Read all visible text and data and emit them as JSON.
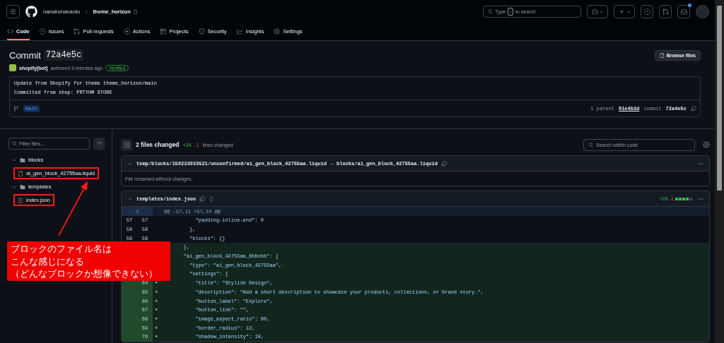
{
  "header": {
    "owner": "nanaironanaoto",
    "separator": "/",
    "repo": "theme_horizon",
    "search": {
      "prefix": "Type",
      "key": "/",
      "suffix": "to search"
    },
    "inbox_unread": true
  },
  "nav": [
    {
      "label": "Code",
      "selected": true
    },
    {
      "label": "Issues",
      "selected": false
    },
    {
      "label": "Pull requests",
      "selected": false
    },
    {
      "label": "Actions",
      "selected": false
    },
    {
      "label": "Projects",
      "selected": false
    },
    {
      "label": "Security",
      "selected": false
    },
    {
      "label": "Insights",
      "selected": false
    },
    {
      "label": "Settings",
      "selected": false
    }
  ],
  "commit": {
    "title": "Commit",
    "sha": "72a4e5c",
    "author": "shopify[bot]",
    "authored": "authored 3 minutes ago",
    "badge": "Verified",
    "browse": "Browse files",
    "message": "Update from Shopify for theme theme_horizon/main",
    "body": "Committed from shop: PRTYHM STORE",
    "branch": "main",
    "parent_label": "1 parent",
    "parent_sha": "01e4b3d",
    "commit_label": "commit",
    "commit_sha": "72a4e5c"
  },
  "sidebar": {
    "filter_placeholder": "Filter files...",
    "tree": [
      {
        "name": "blocks",
        "kind": "folder",
        "expanded": true,
        "children": [
          {
            "name": "ai_gen_block_42755aa.liquid",
            "kind": "renamed",
            "highlighted": true
          }
        ]
      },
      {
        "name": "templates",
        "kind": "folder",
        "expanded": true,
        "children": [
          {
            "name": "index.json",
            "kind": "modified",
            "highlighted": true
          }
        ]
      }
    ]
  },
  "diff": {
    "summary": "2 files changed",
    "additions": "+24",
    "deletions": "-1",
    "summary_suffix": "lines changed",
    "search_placeholder": "Search within code",
    "files": [
      {
        "kind": "renamed",
        "expanded": true,
        "old_path": "temp/blocks/159233933521/unconfirmed/ai_gen_block_42755aa.liquid",
        "arrow": "→",
        "path": "blocks/ai_gen_block_42755aa.liquid",
        "note": "File renamed without changes."
      },
      {
        "kind": "modified",
        "expanded": true,
        "path": "templates/index.json",
        "additions": "+24",
        "deletions": "-1",
        "diffstat": [
          {
            "kind": "added"
          },
          {
            "kind": "added"
          },
          {
            "kind": "added"
          },
          {
            "kind": "added"
          },
          {
            "kind": "neutral"
          }
        ],
        "hunk": "@@ -57,11 +57,34 @@",
        "lines": [
          {
            "kind": "context",
            "old": "57",
            "new": "57",
            "code": "            \"padding-inline-end\": 0"
          },
          {
            "kind": "context",
            "old": "58",
            "new": "58",
            "code": "          },"
          },
          {
            "kind": "context",
            "old": "59",
            "new": "59",
            "code": "          \"blocks\": {}"
          },
          {
            "kind": "added",
            "code": "        },"
          },
          {
            "kind": "added",
            "code": "        \"ai_gen_block_42755aa_6bbcbb\": {"
          },
          {
            "kind": "added",
            "code": "          \"type\": \"ai_gen_block_42755aa\","
          },
          {
            "kind": "added",
            "code": "          \"settings\": {"
          },
          {
            "kind": "added",
            "new": "64",
            "sign": "+",
            "code": "            \"title\": \"Stylish Design\","
          },
          {
            "kind": "added",
            "new": "65",
            "sign": "+",
            "code": "            \"description\": \"Add a short description to showcase your products, collections, or brand story.\","
          },
          {
            "kind": "added",
            "new": "66",
            "sign": "+",
            "code": "            \"button_label\": \"Explore\","
          },
          {
            "kind": "added",
            "new": "67",
            "sign": "+",
            "code": "            \"button_link\": \"\","
          },
          {
            "kind": "added",
            "new": "68",
            "sign": "+",
            "code": "            \"image_aspect_ratio\": 60,"
          },
          {
            "kind": "added",
            "new": "69",
            "sign": "+",
            "code": "            \"border_radius\": 12,"
          },
          {
            "kind": "added",
            "new": "70",
            "sign": "+",
            "code": "            \"shadow_intensity\": 10,"
          }
        ]
      }
    ]
  },
  "annotation": {
    "lines": [
      "ブロックのファイル名は",
      "こんな感じになる",
      "（どんなブロックか想像できない）"
    ]
  }
}
